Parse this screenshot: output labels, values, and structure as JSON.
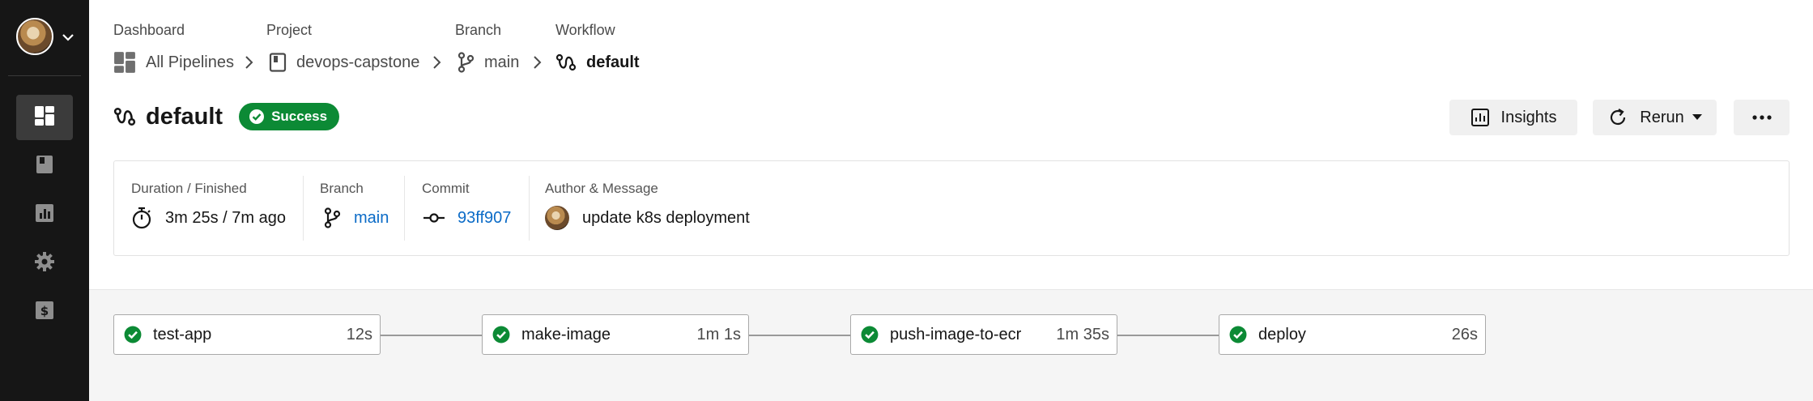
{
  "breadcrumbs": {
    "labels": [
      "Dashboard",
      "Project",
      "Branch",
      "Workflow"
    ],
    "items": [
      "All Pipelines",
      "devops-capstone",
      "main",
      "default"
    ]
  },
  "workflow": {
    "title": "default",
    "status": "Success"
  },
  "actions": {
    "insights_label": "Insights",
    "rerun_label": "Rerun"
  },
  "summary": {
    "duration_label": "Duration / Finished",
    "duration_value": "3m 25s / 7m ago",
    "branch_label": "Branch",
    "branch_value": "main",
    "commit_label": "Commit",
    "commit_value": "93ff907",
    "author_label": "Author & Message",
    "message": "update k8s deployment"
  },
  "jobs": [
    {
      "name": "test-app",
      "duration": "12s",
      "status": "success"
    },
    {
      "name": "make-image",
      "duration": "1m 1s",
      "status": "success"
    },
    {
      "name": "push-image-to-ecr",
      "duration": "1m 35s",
      "status": "success"
    },
    {
      "name": "deploy",
      "duration": "26s",
      "status": "success"
    }
  ],
  "sidebar": {
    "items": [
      {
        "icon": "dashboard-icon",
        "active": true
      },
      {
        "icon": "project-book-icon",
        "active": false
      },
      {
        "icon": "insights-chart-icon",
        "active": false
      },
      {
        "icon": "gear-icon",
        "active": false
      },
      {
        "icon": "billing-dollar-icon",
        "active": false
      }
    ]
  },
  "colors": {
    "sidebar_bg": "#161616",
    "success_green": "#0c8a35",
    "link_blue": "#0b6bc7",
    "workflow_bg": "#f5f5f5"
  }
}
